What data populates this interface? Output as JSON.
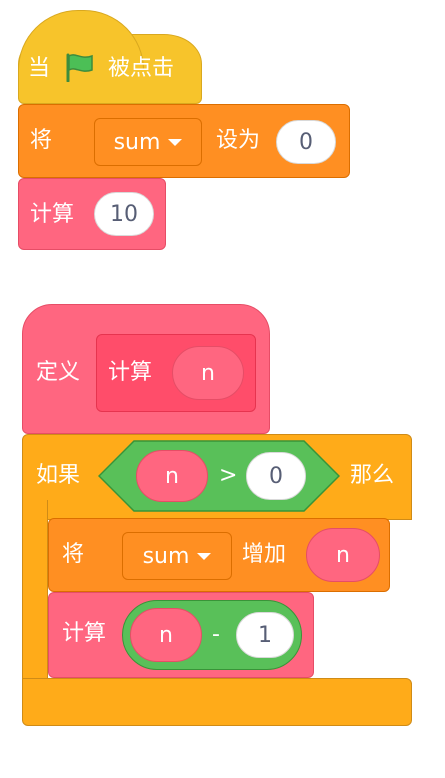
{
  "script1": {
    "hat": {
      "prefix": "当",
      "icon": "green-flag-icon",
      "suffix": "被点击"
    },
    "set_block": {
      "label": "将",
      "variable": "sum",
      "middle": "设为",
      "value": "0"
    },
    "call_block": {
      "label": "计算",
      "arg": "10"
    }
  },
  "script2": {
    "define": {
      "label": "定义",
      "proc_label": "计算",
      "param": "n"
    },
    "if_block": {
      "label": "如果",
      "then_label": "那么",
      "condition": {
        "left": "n",
        "operator": ">",
        "right": "0"
      }
    },
    "change_block": {
      "label": "将",
      "variable": "sum",
      "middle": "增加",
      "value": "n"
    },
    "recursive_call": {
      "label": "计算",
      "expr_left": "n",
      "expr_op": "-",
      "expr_right": "1"
    }
  },
  "colors": {
    "events": "#F7C42B",
    "variables": "#FF8F22",
    "my_blocks": "#FF6680",
    "control": "#FFAB19",
    "operators": "#59C059"
  }
}
